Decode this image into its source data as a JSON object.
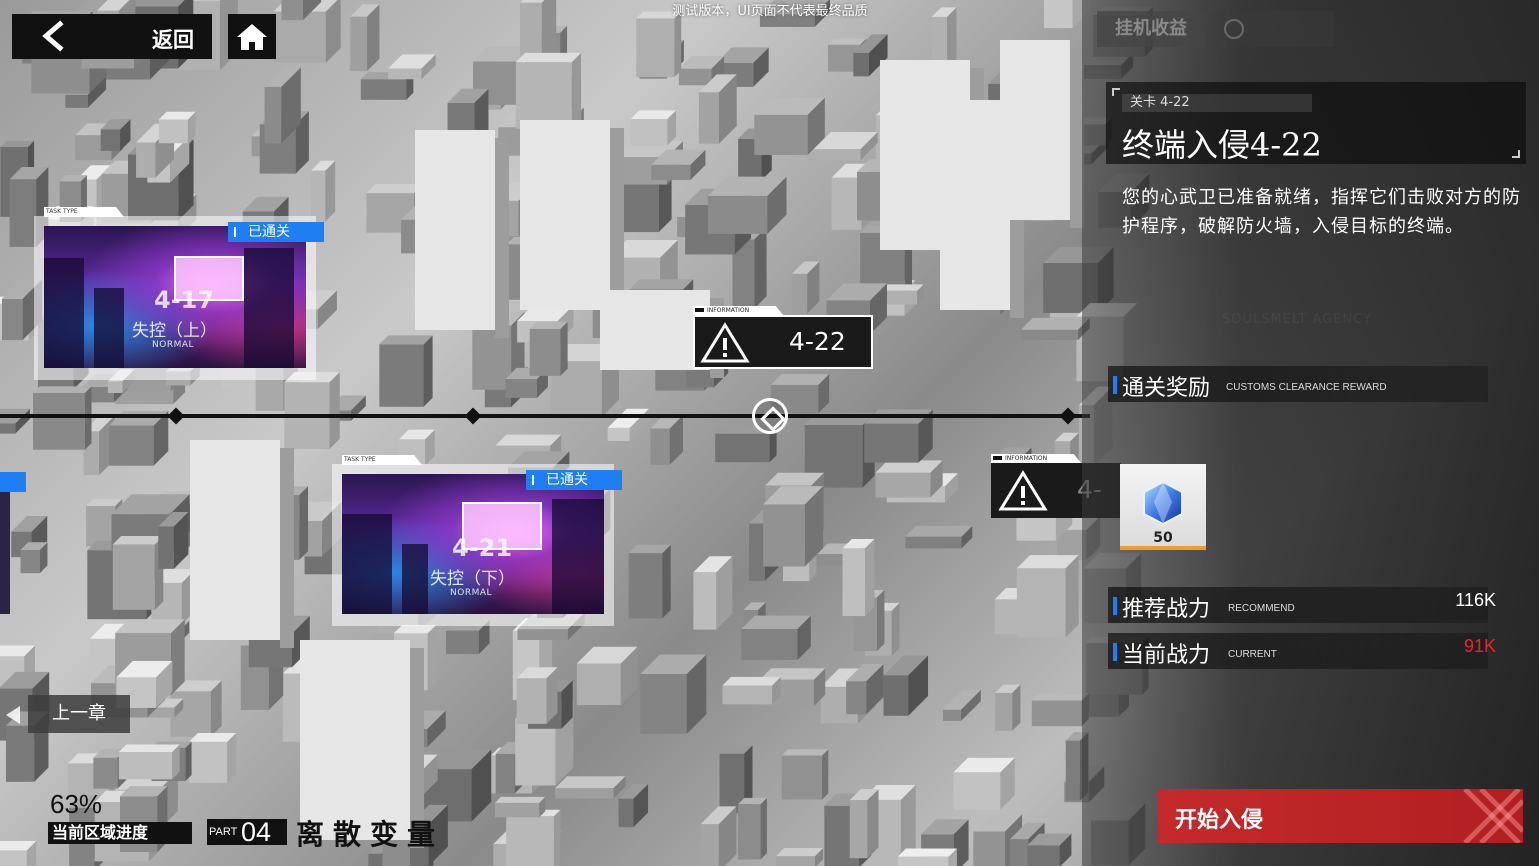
{
  "watermark": "测试版本，UI页面不代表最终品质",
  "nav": {
    "back_label": "返回"
  },
  "stages": [
    {
      "code": "4-17",
      "name": "失控（上）",
      "difficulty": "NORMAL",
      "type_tag": "TASK TYPE",
      "status": "已通关"
    },
    {
      "code": "4-21",
      "name": "失控（下）",
      "difficulty": "NORMAL",
      "type_tag": "TASK TYPE",
      "status": "已通关"
    }
  ],
  "markers": [
    {
      "code": "4-22",
      "header": "INFORMATION"
    },
    {
      "code": "4-",
      "header": "INFORMATION"
    }
  ],
  "prev_chapter": "上一章",
  "progress": {
    "percent": "63%",
    "label": "当前区域进度"
  },
  "part": {
    "word": "PART",
    "number": "04",
    "chapter_name": "离散变量"
  },
  "panel": {
    "tab_idle_rewards": "挂机收益",
    "stage_tag": "关卡 4-22",
    "stage_title": "终端入侵4-22",
    "description": "您的心武卫已准备就绪，指挥它们击败对方的防护程序，破解防火墙，入侵目标的终端。",
    "agency_watermark": "SOULSMELT AGENCY",
    "reward_section": {
      "cn": "通关奖励",
      "en": "CUSTOMS CLEARANCE REWARD"
    },
    "reward_item": {
      "icon": "blue-crystal-icon",
      "quantity": "50"
    },
    "recommend": {
      "cn": "推荐战力",
      "en": "RECOMMEND",
      "value": "116K"
    },
    "current": {
      "cn": "当前战力",
      "en": "CURRENT",
      "value": "91K"
    },
    "start_button": "开始入侵"
  },
  "colors": {
    "accent_blue": "#1e7ef2",
    "danger_red": "#e8242b",
    "start_red": "#c42a2a"
  }
}
